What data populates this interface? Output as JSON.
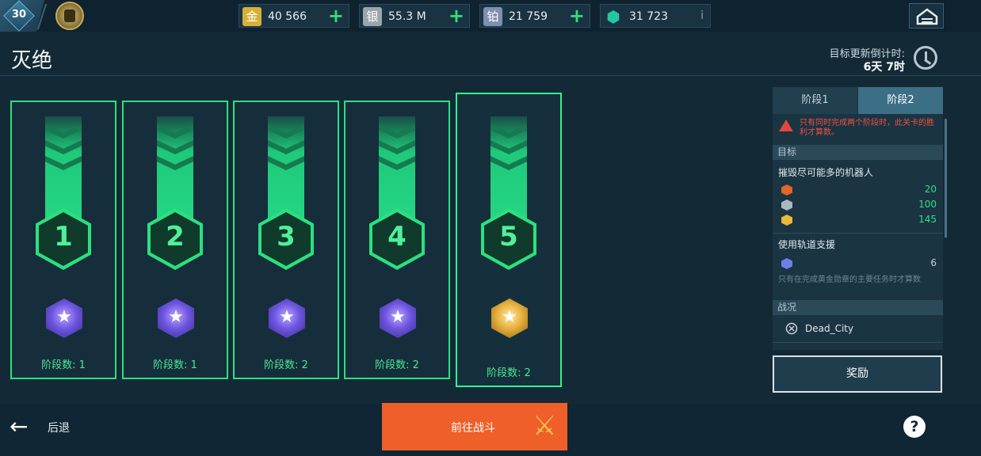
{
  "player": {
    "level": "30"
  },
  "resources": [
    {
      "name": "gold",
      "icon_char": "金",
      "value": "40 566",
      "color": "#d6b03a",
      "action": "+"
    },
    {
      "name": "silver",
      "icon_char": "银",
      "value": "55.3 M",
      "color": "#9aa5ad",
      "action": "+"
    },
    {
      "name": "platinum",
      "icon_char": "铂",
      "value": "21 759",
      "color": "#7f8fb0",
      "action": "+"
    },
    {
      "name": "gem",
      "icon_char": "⬢",
      "value": "31 723",
      "color": "#22c9a0",
      "action": "i"
    }
  ],
  "header": {
    "title": "灭绝",
    "timer_label": "目标更新倒计时:",
    "timer_value": "6天 7时"
  },
  "stages": [
    {
      "number": "1",
      "medal": "blue",
      "medal_star": "★",
      "count_label": "阶段数: 1"
    },
    {
      "number": "2",
      "medal": "blue",
      "medal_star": "★",
      "count_label": "阶段数: 1"
    },
    {
      "number": "3",
      "medal": "blue",
      "medal_star": "★",
      "count_label": "阶段数: 2"
    },
    {
      "number": "4",
      "medal": "blue",
      "medal_star": "★",
      "count_label": "阶段数: 2"
    },
    {
      "number": "5",
      "medal": "gold",
      "medal_star": "★",
      "count_label": "阶段数: 2",
      "selected": true
    }
  ],
  "panel": {
    "tabs": [
      {
        "label": "阶段1",
        "active": false
      },
      {
        "label": "阶段2",
        "active": true
      }
    ],
    "warning": "只有同时完成两个阶段时，此关卡的胜利才算数。",
    "objectives_header": "目标",
    "objective1": {
      "title": "摧毁尽可能多的机器人",
      "rows": [
        {
          "icon": "orange-robot-icon",
          "color": "#e0662a",
          "value": "20"
        },
        {
          "icon": "silver-robot-icon",
          "color": "#aab7bf",
          "value": "100"
        },
        {
          "icon": "gold-robot-icon",
          "color": "#e8b93a",
          "value": "145"
        }
      ]
    },
    "objective2": {
      "title": "使用轨道支援",
      "rows": [
        {
          "icon": "orbital-support-icon",
          "color": "#6c7fe8",
          "value": "6"
        }
      ],
      "note": "只有在完成黄金勋章的主要任务时才算数"
    },
    "battle_header": "战况",
    "map_name": "Dead_City"
  },
  "buttons": {
    "reward": "奖励",
    "back": "后退",
    "back_arrow": "←",
    "fight": "前往战斗",
    "swords": "⚔",
    "help": "?"
  }
}
